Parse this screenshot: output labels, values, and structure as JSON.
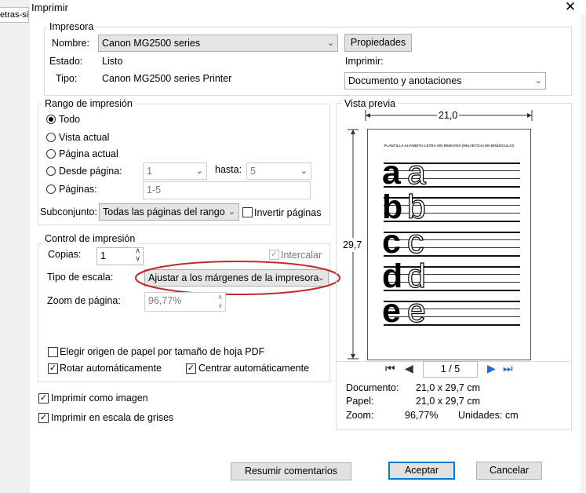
{
  "background": {
    "tab_text": "etras-sin"
  },
  "dialog": {
    "title": "Imprimir",
    "close_glyph": "✕"
  },
  "printer": {
    "group_title": "Impresora",
    "name_label": "Nombre:",
    "name_value": "Canon MG2500 series",
    "status_label": "Estado:",
    "status_value": "Listo",
    "type_label": "Tipo:",
    "type_value": "Canon MG2500 series Printer",
    "properties_button": "Propiedades",
    "print_label": "Imprimir:",
    "print_value": "Documento y anotaciones"
  },
  "range": {
    "group_title": "Rango de impresión",
    "all": "Todo",
    "current_view": "Vista actual",
    "current_page": "Página actual",
    "from_page": "Desde página:",
    "from_value": "1",
    "to_label": "hasta:",
    "to_value": "5",
    "pages": "Páginas:",
    "pages_value": "1-5",
    "subset_label": "Subconjunto:",
    "subset_value": "Todas las páginas del rango",
    "invert": "Invertir páginas"
  },
  "control": {
    "group_title": "Control de impresión",
    "copies_label": "Copias:",
    "copies_value": "1",
    "collate": "Intercalar",
    "scale_label": "Tipo de escala:",
    "scale_value": "Ajustar a los márgenes de la impresora",
    "zoom_label": "Zoom de página:",
    "zoom_value": "96,77%",
    "paper_source": "Elegir origen de papel por tamaño de hoja PDF",
    "auto_rotate": "Rotar automáticamente",
    "auto_center": "Centrar automáticamente"
  },
  "options": {
    "print_as_image": "Imprimir como imagen",
    "grayscale": "Imprimir en escala de grises"
  },
  "preview": {
    "group_title": "Vista previa",
    "width": "21,0",
    "height": "29,7",
    "page_heading": "PLANTILLA ALFABETO LETRA SIN REMATES (HELVÉTICA) EN MINÚSCULAS",
    "letters": [
      "a",
      "b",
      "c",
      "d",
      "e"
    ],
    "page_indicator": "1 / 5",
    "document_label": "Documento:",
    "document_value": "21,0 x 29,7 cm",
    "paper_label": "Papel:",
    "paper_value": "21,0 x 29,7 cm",
    "zoom_label": "Zoom:",
    "zoom_value": "96,77%",
    "units_label": "Unidades:",
    "units_value": "cm"
  },
  "buttons": {
    "summarize": "Resumir comentarios",
    "accept": "Aceptar",
    "cancel": "Cancelar"
  },
  "colors": {
    "accent": "#0078d7",
    "annotation_ellipse": "#c0282d",
    "nav_blue": "#1f6fd1"
  }
}
